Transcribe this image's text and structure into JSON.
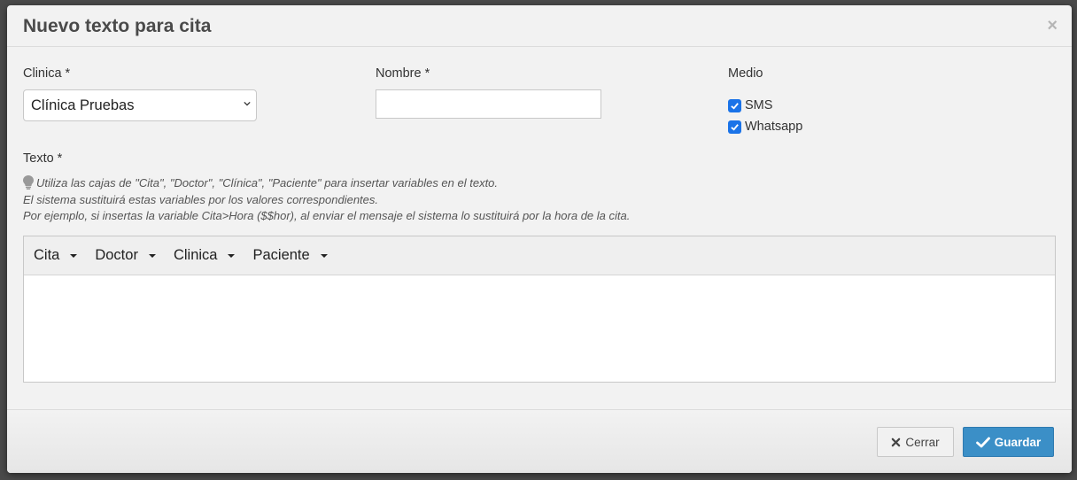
{
  "modal": {
    "title": "Nuevo texto para cita",
    "close_glyph": "×"
  },
  "form": {
    "clinica_label": "Clinica *",
    "clinica_value": "Clínica Pruebas",
    "nombre_label": "Nombre *",
    "nombre_value": "",
    "medio_label": "Medio",
    "medio_options": [
      {
        "label": "SMS",
        "checked": true
      },
      {
        "label": "Whatsapp",
        "checked": true
      }
    ],
    "texto_label": "Texto *",
    "help_lines": [
      "Utiliza las cajas de \"Cita\", \"Doctor\", \"Clínica\", \"Paciente\" para insertar variables en el texto.",
      "El sistema sustituirá estas variables por los valores correspondientes.",
      "Por ejemplo, si insertas la variable Cita>Hora ($$hor), al enviar el mensaje el sistema lo sustituirá por la hora de la cita."
    ]
  },
  "editor": {
    "toolbar": [
      "Cita",
      "Doctor",
      "Clinica",
      "Paciente"
    ],
    "content": ""
  },
  "footer": {
    "close_label": "Cerrar",
    "save_label": "Guardar"
  },
  "colors": {
    "save_button": "#3b8fc7",
    "checkbox": "#1a73e8"
  },
  "icons": {
    "help": "lightbulb-icon",
    "close_button": "times-icon",
    "save_button": "check-icon"
  }
}
